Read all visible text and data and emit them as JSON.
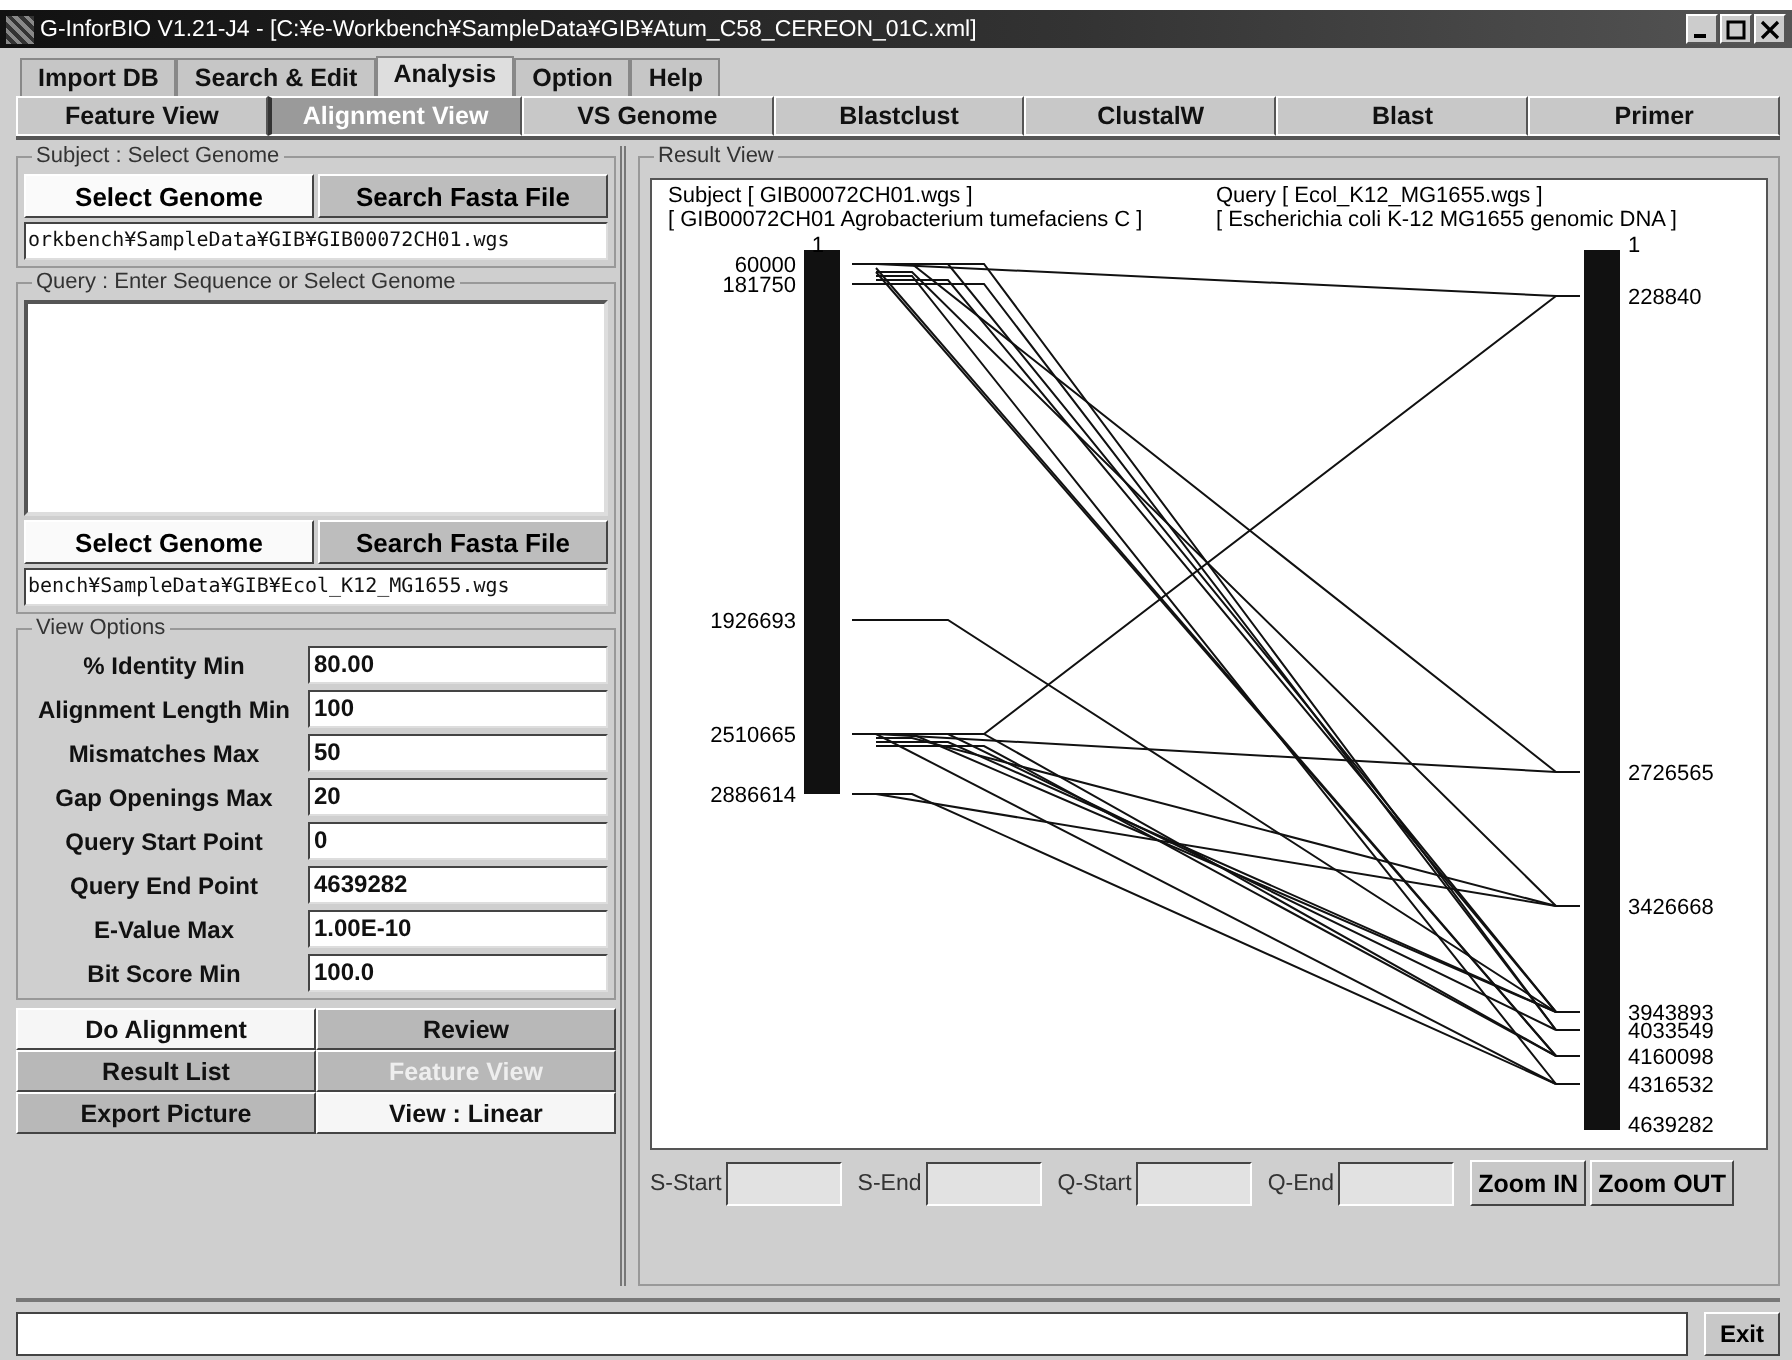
{
  "window": {
    "title": "G-InforBIO V1.21-J4 - [C:¥e-Workbench¥SampleData¥GIB¥Atum_C58_CEREON_01C.xml]"
  },
  "menu_tabs": [
    {
      "label": "Import DB",
      "selected": false
    },
    {
      "label": "Search & Edit",
      "selected": false
    },
    {
      "label": "Analysis",
      "selected": true
    },
    {
      "label": "Option",
      "selected": false
    },
    {
      "label": "Help",
      "selected": false
    }
  ],
  "view_tabs": [
    {
      "label": "Feature View",
      "selected": false
    },
    {
      "label": "Alignment View",
      "selected": true
    },
    {
      "label": "VS Genome",
      "selected": false
    },
    {
      "label": "Blastclust",
      "selected": false
    },
    {
      "label": "ClustalW",
      "selected": false
    },
    {
      "label": "Blast",
      "selected": false
    },
    {
      "label": "Primer",
      "selected": false
    }
  ],
  "subject": {
    "title": "Subject : Select Genome",
    "buttons": [
      {
        "label": "Select Genome",
        "selected": true
      },
      {
        "label": "Search Fasta File",
        "selected": false
      }
    ],
    "path": "orkbench¥SampleData¥GIB¥GIB00072CH01.wgs"
  },
  "query": {
    "title": "Query : Enter Sequence or Select Genome",
    "buttons": [
      {
        "label": "Select Genome",
        "selected": true
      },
      {
        "label": "Search Fasta File",
        "selected": false
      }
    ],
    "path": "bench¥SampleData¥GIB¥Ecol_K12_MG1655.wgs"
  },
  "view_options": {
    "title": "View Options",
    "fields": [
      {
        "label": "% Identity Min",
        "value": "80.00"
      },
      {
        "label": "Alignment Length Min",
        "value": "100"
      },
      {
        "label": "Mismatches Max",
        "value": "50"
      },
      {
        "label": "Gap Openings Max",
        "value": "20"
      },
      {
        "label": "Query Start Point",
        "value": "0"
      },
      {
        "label": "Query End Point",
        "value": "4639282"
      },
      {
        "label": "E-Value Max",
        "value": "1.00E-10"
      },
      {
        "label": "Bit Score Min",
        "value": "100.0"
      }
    ]
  },
  "actions": [
    {
      "label": "Do Alignment",
      "selected": true,
      "disabled": false
    },
    {
      "label": "Review",
      "selected": false,
      "disabled": false
    },
    {
      "label": "Result List",
      "selected": false,
      "disabled": false
    },
    {
      "label": "Feature View",
      "selected": false,
      "disabled": true
    },
    {
      "label": "Export Picture",
      "selected": false,
      "disabled": false
    },
    {
      "label": "View : Linear",
      "selected": true,
      "disabled": false
    }
  ],
  "result_view": {
    "title": "Result View",
    "subject_header": [
      "Subject [ GIB00072CH01.wgs ]",
      "[ GIB00072CH01 Agrobacterium tumefaciens C ]"
    ],
    "query_header": [
      "Query [ Ecol_K12_MG1655.wgs ]",
      "[ Escherichia coli K-12 MG1655 genomic DNA ]"
    ],
    "subject_labels": [
      "1",
      "60000",
      "181750",
      "1926693",
      "2510665",
      "2886614"
    ],
    "query_labels": [
      "1",
      "228840",
      "2726565",
      "3426668",
      "3943893",
      "4033549",
      "4160098",
      "4316532",
      "4639282"
    ],
    "range_fields": [
      {
        "label": "S-Start"
      },
      {
        "label": "S-End"
      },
      {
        "label": "Q-Start"
      },
      {
        "label": "Q-End"
      }
    ],
    "buttons": [
      "Zoom IN",
      "Zoom OUT"
    ]
  },
  "exit_button": "Exit"
}
